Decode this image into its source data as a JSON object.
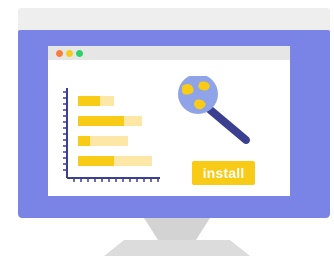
{
  "install_button": {
    "label": "install"
  },
  "window": {
    "traffic_lights": [
      "#f57f3f",
      "#f7cb16",
      "#2fcf6a"
    ]
  },
  "colors": {
    "monitor": "#7a84e6",
    "window_bar": "#e6e6e6",
    "accent_yellow": "#f7cb16",
    "bar_light": "#fce7a6",
    "axis": "#3a3f8f",
    "globe": "#8fa3e8",
    "magnifier_handle": "#3a3f8f"
  },
  "icons": {
    "chart": "bar-chart-icon",
    "search": "magnifier-globe-icon"
  }
}
